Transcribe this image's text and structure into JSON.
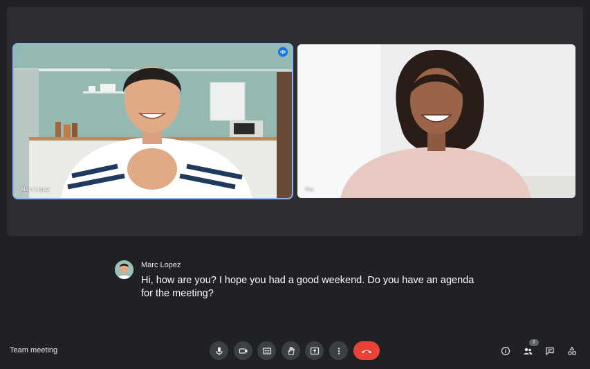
{
  "participants": [
    {
      "name": "Marc Lopez",
      "speaking": true
    },
    {
      "name": "You",
      "speaking": false
    }
  ],
  "caption": {
    "speaker": "Marc Lopez",
    "text": "Hi, how are you? I hope you had a good weekend. Do you have an agenda for the meeting?"
  },
  "meeting": {
    "title": "Team meeting"
  },
  "controls": [
    "mic-icon",
    "camera-icon",
    "captions-icon",
    "raise-hand-icon",
    "present-icon",
    "more-options-icon",
    "end-call-icon"
  ],
  "right_controls": [
    "info-icon",
    "people-icon",
    "chat-icon",
    "activities-icon"
  ],
  "people_count": "2",
  "colors": {
    "end_call": "#ea4335",
    "speaking_border": "#8ab4f8",
    "accent": "#1a73e8",
    "background": "#202124"
  }
}
